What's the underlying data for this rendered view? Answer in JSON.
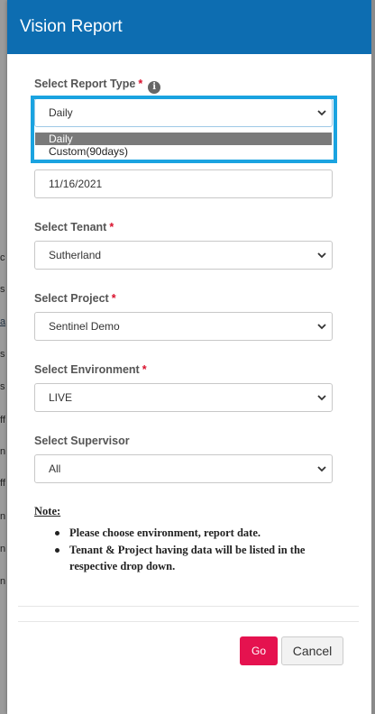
{
  "background": {
    "fragments": [
      "c",
      "s",
      "a",
      "s",
      "s",
      "ff",
      "n",
      "ff",
      "n",
      "n",
      "n"
    ]
  },
  "header": {
    "title": "Vision Report"
  },
  "report_type": {
    "label": "Select Report Type",
    "required_mark": "*",
    "info_icon": "info-icon",
    "value": "Daily",
    "options": [
      "Daily",
      "Custom(90days)"
    ],
    "highlighted_option": "Daily"
  },
  "report_date": {
    "value": "11/16/2021"
  },
  "tenant": {
    "label": "Select Tenant",
    "required_mark": "*",
    "value": "Sutherland"
  },
  "project": {
    "label": "Select Project",
    "required_mark": "*",
    "value": "Sentinel Demo"
  },
  "environment": {
    "label": "Select Environment",
    "required_mark": "*",
    "value": "LIVE"
  },
  "supervisor": {
    "label": "Select Supervisor",
    "value": "All"
  },
  "note": {
    "title": "Note:",
    "items": [
      "Please choose environment, report date.",
      "Tenant & Project having data will be listed in the respective drop down."
    ]
  },
  "footer": {
    "go_label": "Go",
    "cancel_label": "Cancel"
  },
  "colors": {
    "header_bg": "#0d6db1",
    "focus_ring": "#1aa3e0",
    "go_button": "#e5124f",
    "required_mark": "#d9102c"
  }
}
